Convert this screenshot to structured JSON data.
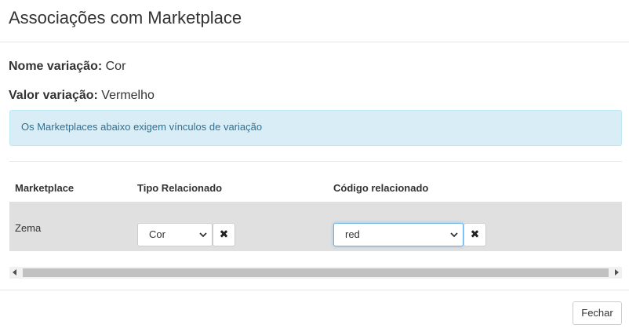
{
  "modal": {
    "title": "Associações com Marketplace",
    "close_label": "Fechar"
  },
  "info": {
    "variation_name_label": "Nome variação:",
    "variation_name_value": "Cor",
    "variation_value_label": "Valor variação:",
    "variation_value_value": "Vermelho"
  },
  "alert": {
    "text": "Os Marketplaces abaixo exigem vínculos de variação"
  },
  "table": {
    "headers": [
      "Marketplace",
      "Tipo Relacionado",
      "Código relacionado"
    ],
    "rows": [
      {
        "marketplace": "Zema",
        "tipo_relacionado": "Cor",
        "codigo_relacionado": "red",
        "clear_icon": "times-icon"
      }
    ]
  },
  "colors": {
    "alert_bg": "#d9edf7",
    "alert_text": "#31708f",
    "row_bg": "#e0e0e0",
    "focus_border": "#66afe9"
  }
}
